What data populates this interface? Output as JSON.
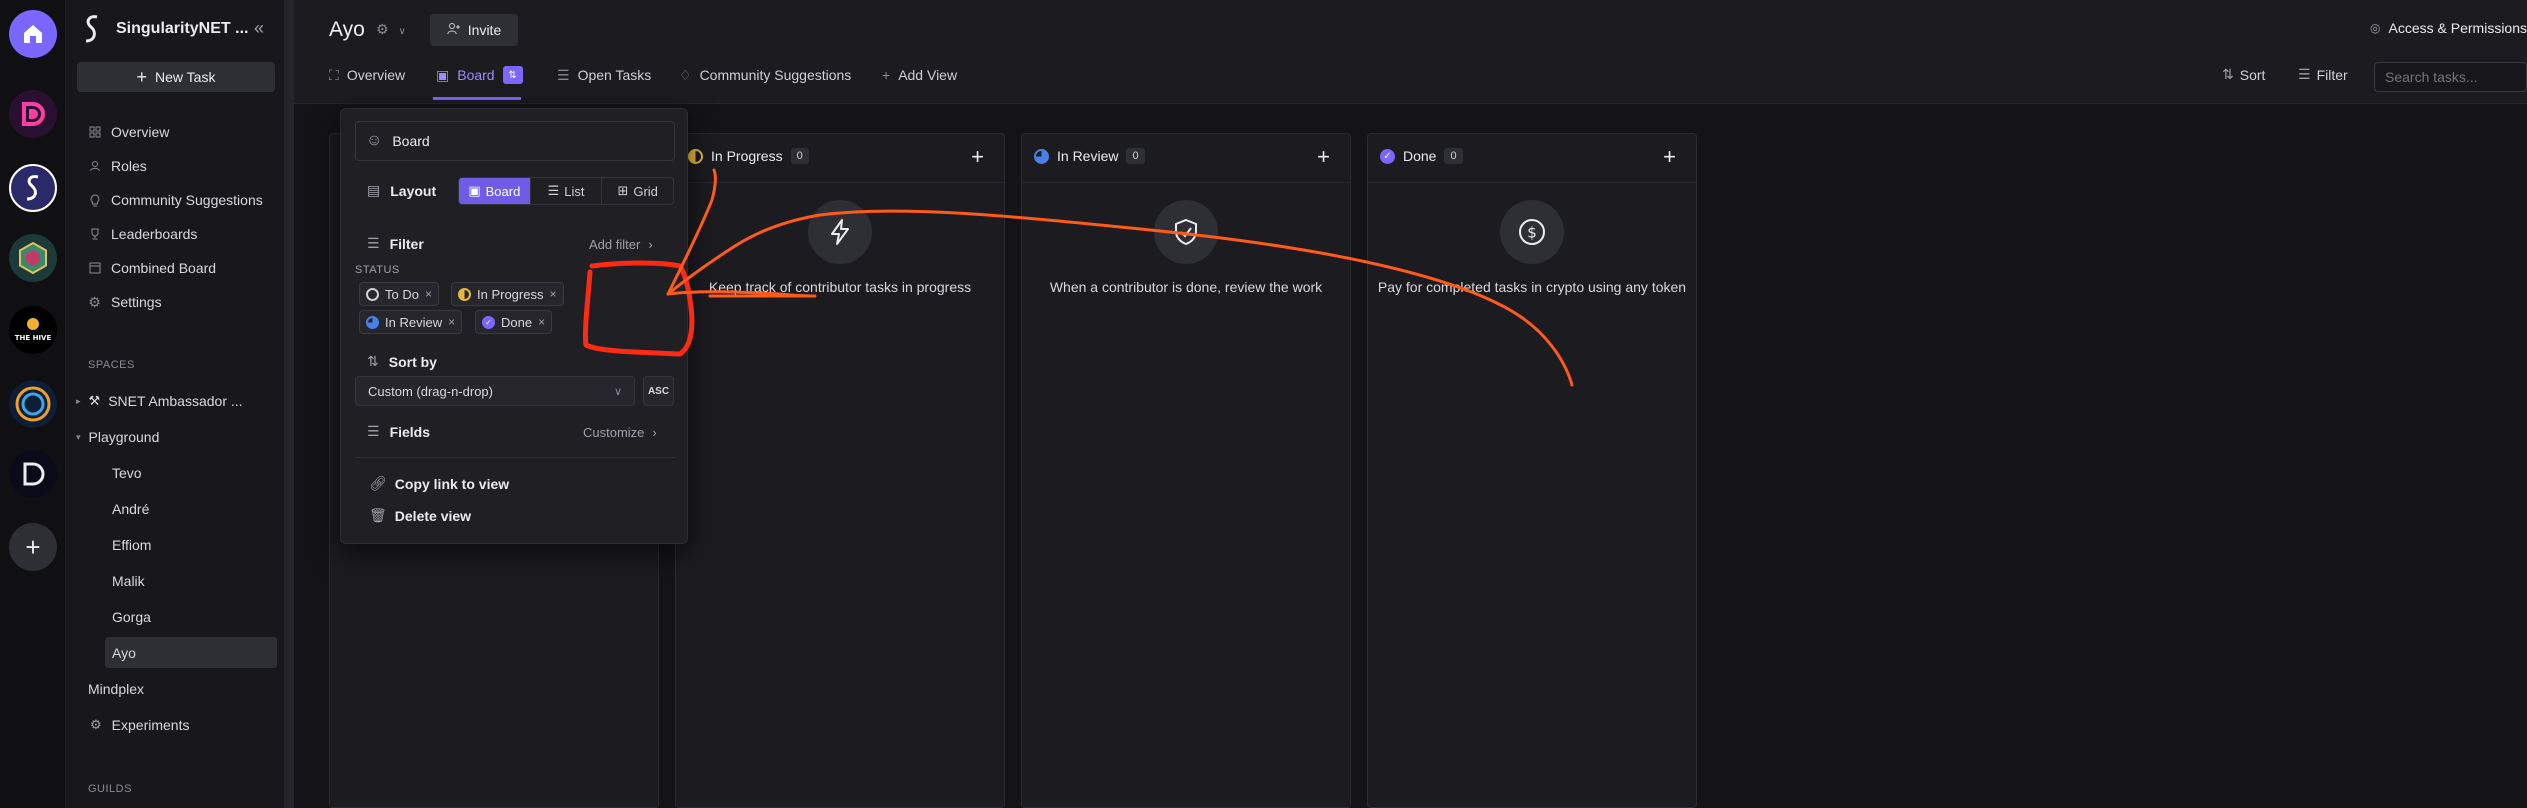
{
  "workspace": {
    "name": "SingularityNET ...",
    "new_task_label": "New Task"
  },
  "sidebar": {
    "nav": [
      {
        "label": "Overview",
        "icon": "grid-icon"
      },
      {
        "label": "Roles",
        "icon": "user-icon"
      },
      {
        "label": "Community Suggestions",
        "icon": "lightbulb-icon"
      },
      {
        "label": "Leaderboards",
        "icon": "trophy-icon"
      },
      {
        "label": "Combined Board",
        "icon": "board-icon"
      },
      {
        "label": "Settings",
        "icon": "gear-icon"
      }
    ],
    "spaces_label": "SPACES",
    "spaces": {
      "ambassador": "SNET Ambassador ...",
      "playground": "Playground",
      "children": [
        "Tevo",
        "André",
        "Effiom",
        "Malik",
        "Gorga",
        "Ayo"
      ],
      "mindplex": "Mindplex",
      "experiments": "Experiments"
    },
    "guilds_label": "GUILDS"
  },
  "header": {
    "title": "Ayo",
    "invite_label": "Invite",
    "access_label": "Access & Permissions",
    "tabs": [
      {
        "label": "Overview"
      },
      {
        "label": "Board",
        "badge": "⇅"
      },
      {
        "label": "Open Tasks"
      },
      {
        "label": "Community Suggestions"
      },
      {
        "label": "Add View"
      }
    ],
    "sort_label": "Sort",
    "filter_label": "Filter",
    "search_placeholder": "Search tasks..."
  },
  "columns": [
    {
      "title": "In Progress",
      "count": "0",
      "desc": "Keep track of contributor tasks in progress",
      "icon": "lightning-icon",
      "color": "#e8b93a"
    },
    {
      "title": "In Review",
      "count": "0",
      "desc": "When a contributor is done, review the work",
      "icon": "shield-icon",
      "color": "#4a7fe8"
    },
    {
      "title": "Done",
      "count": "0",
      "desc": "Pay for completed tasks in crypto using any token",
      "icon": "dollar-icon",
      "color": "#7b66ff"
    }
  ],
  "popup": {
    "view_name": "Board",
    "layout_label": "Layout",
    "layout_options": [
      "Board",
      "List",
      "Grid"
    ],
    "filter_label": "Filter",
    "add_filter_label": "Add filter",
    "status_label": "STATUS",
    "chips": [
      "To Do",
      "In Progress",
      "In Review",
      "Done"
    ],
    "sort_label": "Sort by",
    "sort_value": "Custom (drag-n-drop)",
    "sort_dir": "ASC",
    "fields_label": "Fields",
    "customize_label": "Customize",
    "copy_link_label": "Copy link to view",
    "delete_label": "Delete view"
  },
  "colors": {
    "accent": "#7b66ff",
    "annotation": "#ff3b1f",
    "annotation_orange": "#ff6a1a"
  }
}
